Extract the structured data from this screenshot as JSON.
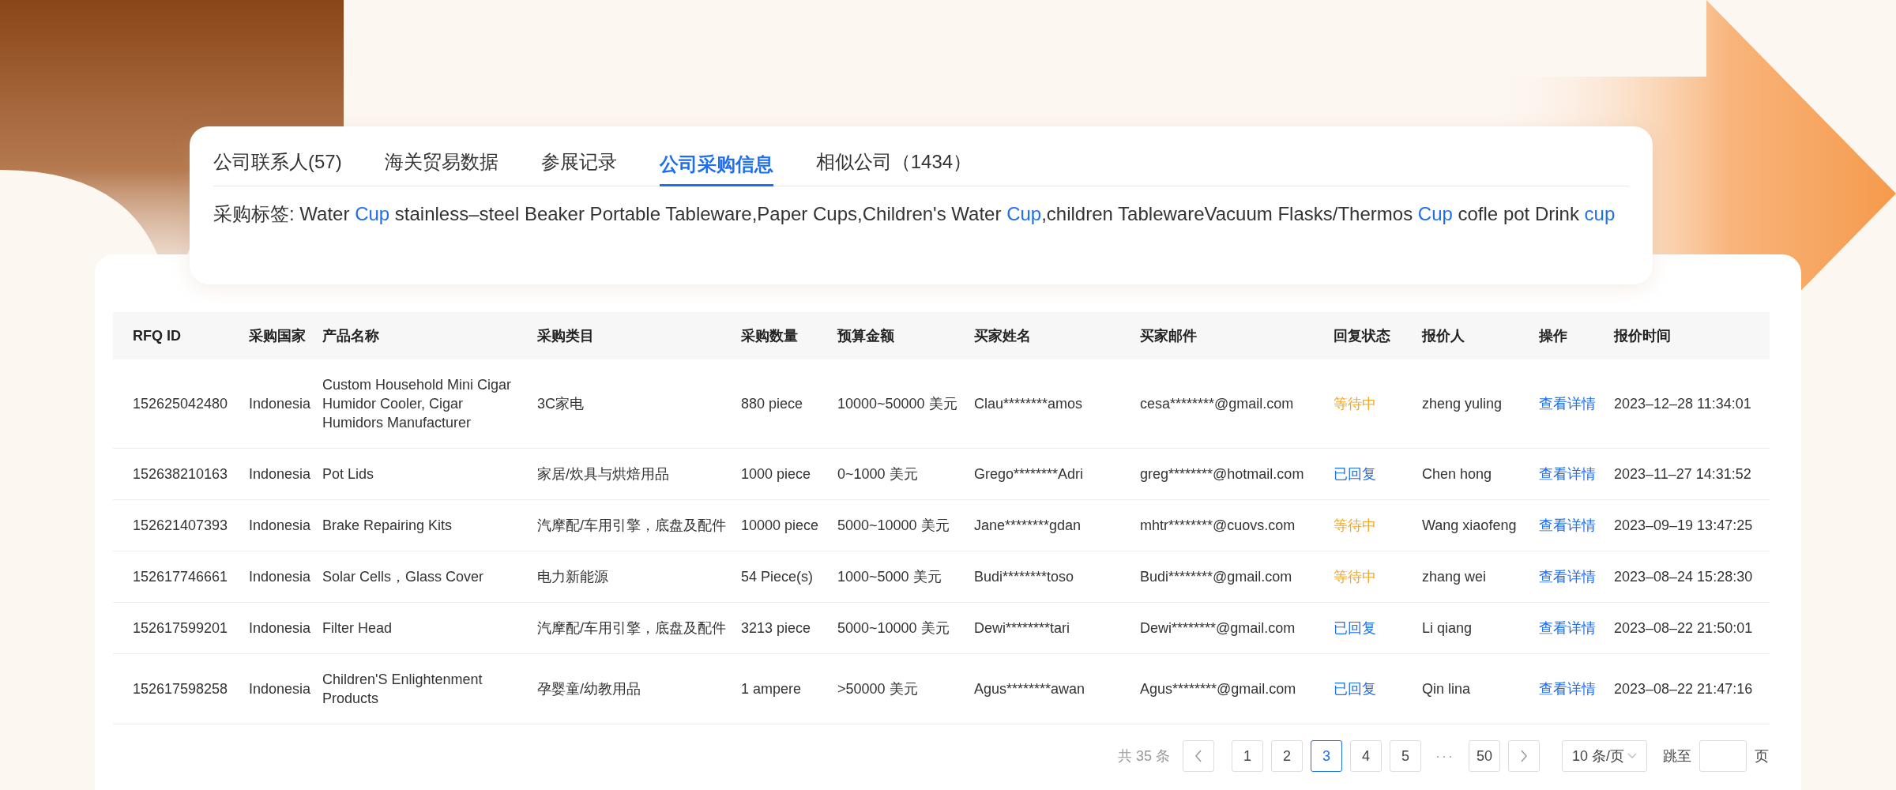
{
  "tabs": [
    {
      "label": "公司联系人(57)",
      "selected": false
    },
    {
      "label": "海关贸易数据",
      "selected": false
    },
    {
      "label": "参展记录",
      "selected": false
    },
    {
      "label": "公司采购信息",
      "selected": true
    },
    {
      "label": "相似公司（1434）",
      "selected": false
    }
  ],
  "purchase_tags": [
    {
      "text": "采购标签: Water ",
      "highlight": false
    },
    {
      "text": "Cup",
      "highlight": true
    },
    {
      "text": " stainless–steel Beaker Portable Tableware,Paper Cups,Children's Water ",
      "highlight": false
    },
    {
      "text": "Cup",
      "highlight": true
    },
    {
      "text": ",children TablewareVacuum Flasks/Thermos ",
      "highlight": false
    },
    {
      "text": "Cup",
      "highlight": true
    },
    {
      "text": " cofle pot Drink ",
      "highlight": false
    },
    {
      "text": "cup",
      "highlight": true
    }
  ],
  "table": {
    "columns": [
      "RFQ ID",
      "采购国家",
      "产品名称",
      "采购类目",
      "采购数量",
      "预算金额",
      "买家姓名",
      "买家邮件",
      "回复状态",
      "报价人",
      "操作",
      "报价时间"
    ],
    "rows": [
      {
        "rfq_id": "152625042480",
        "country": "Indonesia",
        "product": "Custom Household Mini Cigar Humidor Cooler, Cigar Humidors Manufacturer",
        "category": "3C家电",
        "quantity": "880 piece",
        "budget": "10000~50000 美元",
        "buyer": "Clau********amos",
        "email": "cesa********@gmail.com",
        "status": {
          "text": "等待中",
          "kind": "pending"
        },
        "quoter": "zheng yuling",
        "action": "查看详情",
        "time": "2023–12–28 11:34:01"
      },
      {
        "rfq_id": "152638210163",
        "country": "Indonesia",
        "product": "Pot Lids",
        "category": "家居/炊具与烘焙用品",
        "quantity": "1000 piece",
        "budget": "0~1000 美元",
        "buyer": "Grego********Adri",
        "email": "greg********@hotmail.com",
        "status": {
          "text": "已回复",
          "kind": "replied"
        },
        "quoter": "Chen hong",
        "action": "查看详情",
        "time": "2023–11–27 14:31:52"
      },
      {
        "rfq_id": "152621407393",
        "country": "Indonesia",
        "product": "Brake Repairing Kits",
        "category": "汽摩配/车用引擎，底盘及配件",
        "quantity": "10000 piece",
        "budget": "5000~10000 美元",
        "buyer": "Jane********gdan",
        "email": "mhtr********@cuovs.com",
        "status": {
          "text": "等待中",
          "kind": "pending"
        },
        "quoter": "Wang xiaofeng",
        "action": "查看详情",
        "time": "2023–09–19 13:47:25"
      },
      {
        "rfq_id": "152617746661",
        "country": "Indonesia",
        "product": "Solar Cells，Glass Cover",
        "category": "电力新能源",
        "quantity": "54 Piece(s)",
        "budget": "1000~5000 美元",
        "buyer": "Budi********toso",
        "email": "Budi********@gmail.com",
        "status": {
          "text": "等待中",
          "kind": "pending"
        },
        "quoter": "zhang wei",
        "action": "查看详情",
        "time": "2023–08–24 15:28:30"
      },
      {
        "rfq_id": "152617599201",
        "country": "Indonesia",
        "product": "Filter Head",
        "category": "汽摩配/车用引擎，底盘及配件",
        "quantity": "3213 piece",
        "budget": "5000~10000 美元",
        "buyer": "Dewi********tari",
        "email": "Dewi********@gmail.com",
        "status": {
          "text": "已回复",
          "kind": "replied"
        },
        "quoter": "Li qiang",
        "action": "查看详情",
        "time": "2023–08–22 21:50:01"
      },
      {
        "rfq_id": "152617598258",
        "country": "Indonesia",
        "product": "Children'S Enlightenment Products",
        "category": "孕婴童/幼教用品",
        "quantity": "1 ampere",
        "budget": ">50000 美元",
        "buyer": "Agus********awan",
        "email": "Agus********@gmail.com",
        "status": {
          "text": "已回复",
          "kind": "replied"
        },
        "quoter": "Qin lina",
        "action": "查看详情",
        "time": "2023–08–22 21:47:16"
      }
    ]
  },
  "pagination": {
    "total": "共 35 条",
    "pages": [
      {
        "label": "1",
        "selected": false
      },
      {
        "label": "2",
        "selected": false
      },
      {
        "label": "3",
        "selected": true
      },
      {
        "label": "4",
        "selected": false
      },
      {
        "label": "5",
        "selected": false
      },
      {
        "label": "···",
        "kind": "ellipsis"
      },
      {
        "label": "50",
        "selected": false
      }
    ],
    "page_size": "10 条/页",
    "jump_label": "跳至",
    "jump_suffix": "页"
  }
}
